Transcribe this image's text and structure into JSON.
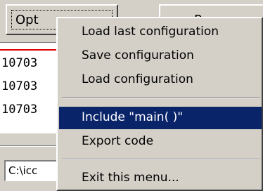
{
  "toolbar": {
    "options_label": "Opt",
    "right_button_label": "Pr"
  },
  "list": {
    "rows": [
      "10703",
      "10703",
      "10703"
    ]
  },
  "path_field": {
    "value": "C:\\icc"
  },
  "menu": {
    "items": [
      {
        "label": "Load last configuration"
      },
      {
        "label": "Save configuration"
      },
      {
        "label": "Load configuration"
      },
      {
        "label": "Include \"main( )\""
      },
      {
        "label": "Export code"
      },
      {
        "label": "Exit this menu..."
      }
    ],
    "highlight_color": "#0a246a"
  }
}
